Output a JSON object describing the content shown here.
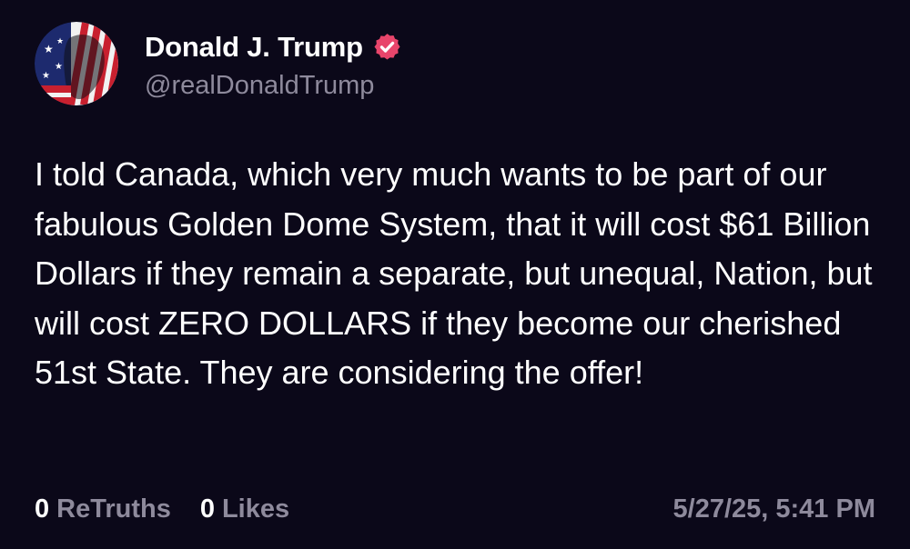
{
  "post": {
    "author": {
      "display_name": "Donald J. Trump",
      "handle": "@realDonaldTrump",
      "verified_icon": "verified-badge-icon",
      "verified_color": "#e8456b"
    },
    "text": "I told Canada, which very much wants to be part of our fabulous Golden Dome System, that it will cost $61 Billion Dollars if they remain a separate, but unequal, Nation, but will cost ZERO DOLLARS if they become our cherished 51st State. They are considering the offer!",
    "stats": {
      "retruths_count": "0",
      "retruths_label": "ReTruths",
      "likes_count": "0",
      "likes_label": "Likes"
    },
    "timestamp": "5/27/25, 5:41 PM"
  },
  "colors": {
    "background": "#0b0819",
    "text": "#ffffff",
    "muted": "#8e8a9c"
  }
}
